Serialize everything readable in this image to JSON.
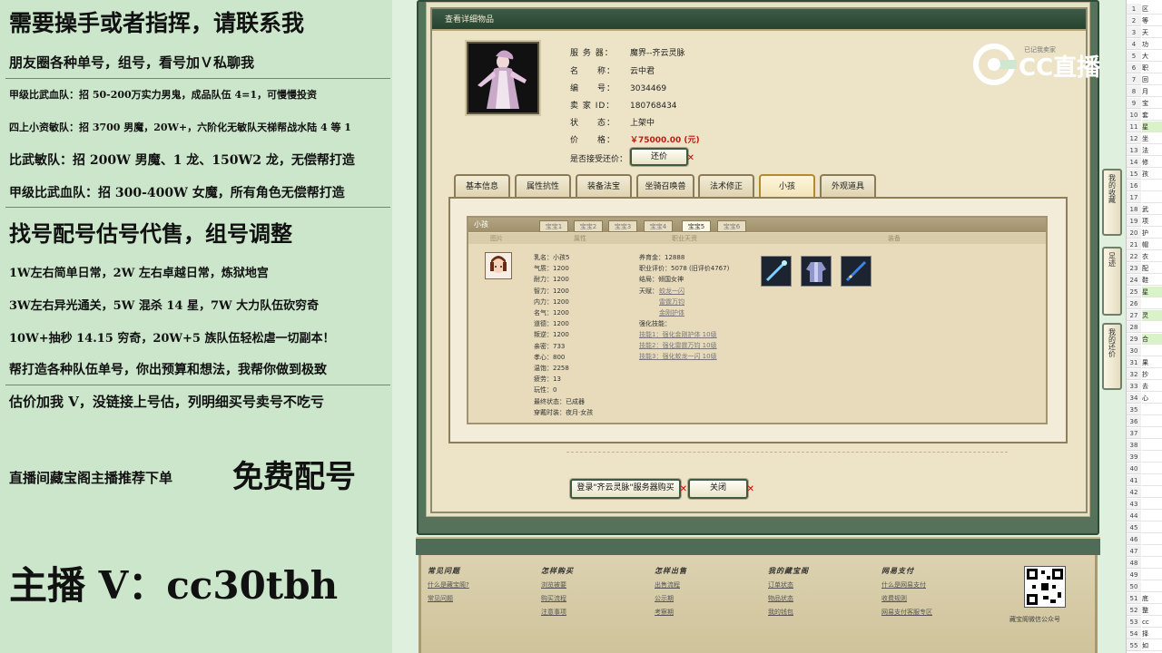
{
  "promo": {
    "line1": "需要操手或者指挥，请联系我",
    "line2": "朋友圈各种单号，组号，看号加Ｖ私聊我",
    "line3": "甲级比武血队：招 50-200万实力男鬼，成品队伍 4=1，可慢慢投资",
    "line4": "四上小资敏队：招 3700 男魔，20W+，六阶化无敏队天梯帮战水陆 4 等 1",
    "line5": "比武敏队：招 200W 男魔、1 龙、150W2 龙，无偿帮打造",
    "line6": "甲级比武血队：招 300-400W 女魔，所有角色无偿帮打造",
    "line7": "找号配号估号代售，组号调整",
    "line8": "1W左右简单日常，2W 左右卓越日常，炼狱地宫",
    "line9": "3W左右异光通关，5W 混杀 14 星，7W 大力队伍砍穷奇",
    "line10": "10W+抽秒 14.15 穷奇，20W+5 族队伍轻松虐一切副本！",
    "line11": "帮打造各种队伍单号，你出预算和想法，我帮你做到极致",
    "line12": "估价加我 V，没链接上号估，列明细买号卖号不吃亏",
    "line13a": "直播间藏宝阁主播推荐下单",
    "line13b": "免费配号",
    "line14": "主播 V：cc30tbh"
  },
  "logo": {
    "text": "CC直播",
    "partial": "已记我卖家"
  },
  "dialog": {
    "title": "查看详细物品",
    "server_k": "服 务 器：",
    "server_v": "魔界--齐云灵脉",
    "name_k": "名　　称：",
    "name_v": "云中君",
    "id_k": "编　　号：",
    "id_v": "3034469",
    "seller_k": "卖 家 ID：",
    "seller_v": "180768434",
    "status_k": "状　　态：",
    "status_v": "上架中",
    "price_k": "价　　格：",
    "price_v": "￥75000.00 (元)",
    "bargain_k": "是否接受还价：",
    "bargain_btn": "还价",
    "buy_btn": "登录\"齐云灵脉\"服务器购买",
    "close_btn": "关闭"
  },
  "tabs": [
    "基本信息",
    "属性抗性",
    "装备法宝",
    "坐骑召唤兽",
    "法术修正",
    "小孩",
    "外观道具"
  ],
  "child": {
    "title": "小孩",
    "subtabs": [
      "宝宝1",
      "宝宝2",
      "宝宝3",
      "宝宝4",
      "宝宝5",
      "宝宝6"
    ],
    "headers": [
      "图片",
      "属性",
      "职业天资",
      "装备"
    ],
    "stats": [
      [
        "乳名",
        "小孩5"
      ],
      [
        "气质",
        "1200"
      ],
      [
        "耐力",
        "1200"
      ],
      [
        "智力",
        "1200"
      ],
      [
        "内力",
        "1200"
      ],
      [
        "名气",
        "1200"
      ],
      [
        "道德",
        "1200"
      ],
      [
        "叛逆",
        "1200"
      ],
      [
        "亲密",
        "733"
      ],
      [
        "孝心",
        "800"
      ],
      [
        "温饱",
        "2258"
      ],
      [
        "疲劳",
        "13"
      ],
      [
        "玩性",
        "0"
      ],
      [
        "最终状态",
        "已成器"
      ],
      [
        "穿戴时装",
        "夜月·女孩"
      ]
    ],
    "career": {
      "fund_k": "养育金：",
      "fund_v": "12888",
      "eval_k": "职业评价：",
      "eval_v": "5078 (旧评价4767)",
      "ending_k": "结局：",
      "ending_v": "倾国女神",
      "talent_k": "天赋：",
      "talents": [
        "蛟龙一闪",
        "雷霆万钧",
        "金刚护体"
      ],
      "skill_k": "强化技能：",
      "skills": [
        "技能1：强化金刚护体 10级",
        "技能2：强化雷霆万钧 10级",
        "技能3：强化蛟龙一闪 10级"
      ]
    }
  },
  "side": {
    "fav": "我的收藏",
    "foot": "足迹",
    "back": "我的还价"
  },
  "footer": {
    "cols": [
      {
        "h": "常见问题",
        "links": [
          "什么是藏宝阁?",
          "常见问题"
        ]
      },
      {
        "h": "怎样购买",
        "links": [
          "浏览被要",
          "购买流程",
          "注意事项"
        ]
      },
      {
        "h": "怎样出售",
        "links": [
          "出售流程",
          "公示期",
          "考察期"
        ]
      },
      {
        "h": "我的藏宝阁",
        "links": [
          "订单状态",
          "物品状态",
          "我的钱包"
        ]
      },
      {
        "h": "网易支付",
        "links": [
          "什么是网易支付",
          "收费规则",
          "网易支付客服专区"
        ]
      }
    ],
    "qr_caption": "藏宝阁微信公众号"
  },
  "sheet": {
    "rows": [
      [
        "1",
        "区"
      ],
      [
        "2",
        "等"
      ],
      [
        "3",
        "天"
      ],
      [
        "4",
        "功"
      ],
      [
        "5",
        "大"
      ],
      [
        "6",
        "职"
      ],
      [
        "7",
        "回"
      ],
      [
        "8",
        "月"
      ],
      [
        "9",
        "宝"
      ],
      [
        "10",
        "套"
      ],
      [
        "11",
        "星"
      ],
      [
        "12",
        "坐"
      ],
      [
        "13",
        "法"
      ],
      [
        "14",
        "修"
      ],
      [
        "15",
        "孩"
      ],
      [
        "16",
        ""
      ],
      [
        "17",
        ""
      ],
      [
        "18",
        "武"
      ],
      [
        "19",
        "项"
      ],
      [
        "20",
        "护"
      ],
      [
        "21",
        "帽"
      ],
      [
        "22",
        "衣"
      ],
      [
        "23",
        "配"
      ],
      [
        "24",
        "鞋"
      ],
      [
        "25",
        "星"
      ],
      [
        "26",
        ""
      ],
      [
        "27",
        "灵"
      ],
      [
        "28",
        ""
      ],
      [
        "29",
        "合"
      ],
      [
        "30",
        ""
      ],
      [
        "31",
        "果"
      ],
      [
        "32",
        "抄"
      ],
      [
        "33",
        "去"
      ],
      [
        "34",
        "心"
      ],
      [
        "35",
        ""
      ],
      [
        "36",
        ""
      ],
      [
        "37",
        ""
      ],
      [
        "38",
        ""
      ],
      [
        "39",
        ""
      ],
      [
        "40",
        ""
      ],
      [
        "41",
        ""
      ],
      [
        "42",
        ""
      ],
      [
        "43",
        ""
      ],
      [
        "44",
        ""
      ],
      [
        "45",
        ""
      ],
      [
        "46",
        ""
      ],
      [
        "47",
        ""
      ],
      [
        "48",
        ""
      ],
      [
        "49",
        ""
      ],
      [
        "50",
        ""
      ],
      [
        "51",
        "底"
      ],
      [
        "52",
        "整"
      ],
      [
        "53",
        "cc"
      ],
      [
        "54",
        "择"
      ],
      [
        "55",
        "如"
      ]
    ]
  }
}
